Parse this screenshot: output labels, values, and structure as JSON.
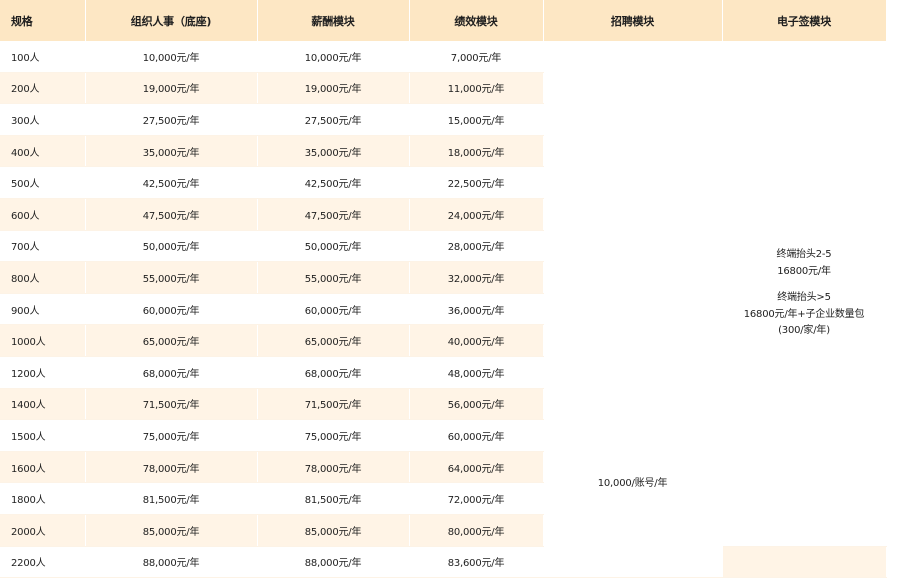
{
  "headers": [
    "规格",
    "组织人事（底座)",
    "薪酬模块",
    "绩效模块",
    "招聘模块",
    "电子签模块"
  ],
  "rows": [
    {
      "scale": "100人",
      "org": "10,000元/年",
      "salary": "10,000元/年",
      "perf": "7,000元/年"
    },
    {
      "scale": "200人",
      "org": "19,000元/年",
      "salary": "19,000元/年",
      "perf": "11,000元/年"
    },
    {
      "scale": "300人",
      "org": "27,500元/年",
      "salary": "27,500元/年",
      "perf": "15,000元/年"
    },
    {
      "scale": "400人",
      "org": "35,000元/年",
      "salary": "35,000元/年",
      "perf": "18,000元/年"
    },
    {
      "scale": "500人",
      "org": "42,500元/年",
      "salary": "42,500元/年",
      "perf": "22,500元/年"
    },
    {
      "scale": "600人",
      "org": "47,500元/年",
      "salary": "47,500元/年",
      "perf": "24,000元/年"
    },
    {
      "scale": "700人",
      "org": "50,000元/年",
      "salary": "50,000元/年",
      "perf": "28,000元/年"
    },
    {
      "scale": "800人",
      "org": "55,000元/年",
      "salary": "55,000元/年",
      "perf": "32,000元/年"
    },
    {
      "scale": "900人",
      "org": "60,000元/年",
      "salary": "60,000元/年",
      "perf": "36,000元/年"
    },
    {
      "scale": "1000人",
      "org": "65,000元/年",
      "salary": "65,000元/年",
      "perf": "40,000元/年"
    },
    {
      "scale": "1200人",
      "org": "68,000元/年",
      "salary": "68,000元/年",
      "perf": "48,000元/年"
    },
    {
      "scale": "1400人",
      "org": "71,500元/年",
      "salary": "71,500元/年",
      "perf": "56,000元/年"
    },
    {
      "scale": "1500人",
      "org": "75,000元/年",
      "salary": "75,000元/年",
      "perf": "60,000元/年"
    },
    {
      "scale": "1600人",
      "org": "78,000元/年",
      "salary": "78,000元/年",
      "perf": "64,000元/年"
    },
    {
      "scale": "1800人",
      "org": "81,500元/年",
      "salary": "81,500元/年",
      "perf": "72,000元/年"
    },
    {
      "scale": "2000人",
      "org": "85,000元/年",
      "salary": "85,000元/年",
      "perf": "80,000元/年"
    },
    {
      "scale": "2200人",
      "org": "88,000元/年",
      "salary": "88,000元/年",
      "perf": "83,600元/年"
    }
  ],
  "recruit": "10,000/账号/年",
  "esign": {
    "line1": "终端抬头2-5",
    "line2": "16800元/年",
    "line3": "终端抬头>5",
    "line4": "16800元/年+子企业数量包",
    "line5": "(300/家/年)"
  },
  "colors": {
    "header_bg": "#fde7c4",
    "stripe_bg": "#fff4e6"
  }
}
